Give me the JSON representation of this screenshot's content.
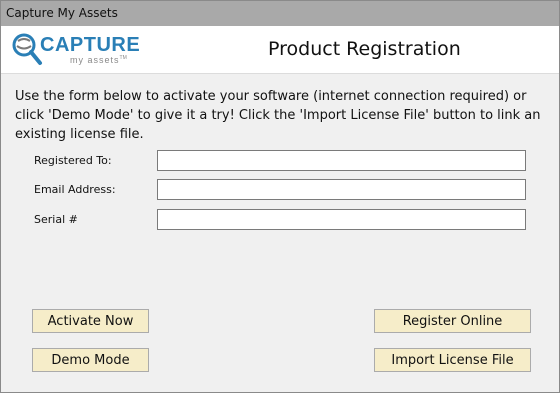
{
  "window": {
    "title": "Capture My Assets"
  },
  "header": {
    "logo": {
      "top_text": "CAPTURE",
      "bottom_text": "my assets",
      "trademark": "TM",
      "icon": "magnifier-lens-icon"
    },
    "title": "Product Registration"
  },
  "intro_text": "Use the form below to activate your software (internet connection required) or click 'Demo Mode' to give it a try! Click the 'Import License File' button to link an existing license file.",
  "form": {
    "registered_to": {
      "label": "Registered To:",
      "value": ""
    },
    "email_address": {
      "label": "Email Address:",
      "value": ""
    },
    "serial": {
      "label": "Serial #",
      "value": ""
    }
  },
  "buttons": {
    "activate_now": "Activate Now",
    "demo_mode": "Demo Mode",
    "register_online": "Register Online",
    "import_license_file": "Import License File"
  },
  "colors": {
    "titlebar": "#a9a9a9",
    "button_background": "#f6edc9",
    "logo_blue": "#2a7fb6"
  }
}
